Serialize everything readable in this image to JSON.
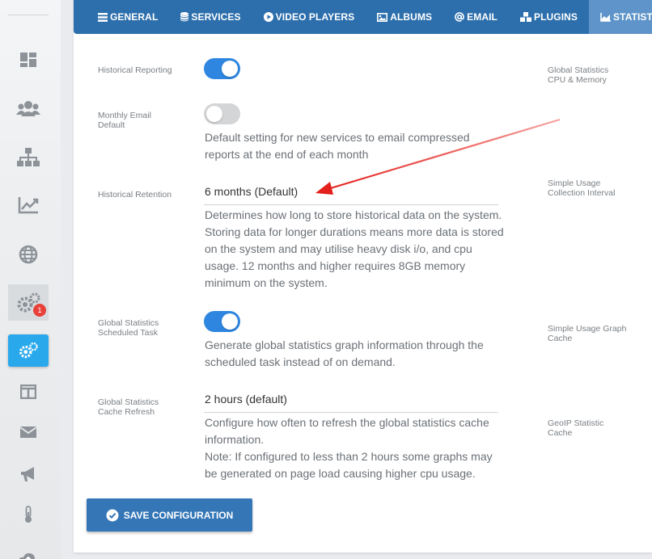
{
  "tabs": [
    {
      "label": "GENERAL",
      "icon": "list-icon",
      "active": false
    },
    {
      "label": "SERVICES",
      "icon": "database-icon",
      "active": false
    },
    {
      "label": "VIDEO PLAYERS",
      "icon": "play-circle-icon",
      "active": false
    },
    {
      "label": "ALBUMS",
      "icon": "image-icon",
      "active": false
    },
    {
      "label": "EMAIL",
      "icon": "at-icon",
      "active": false
    },
    {
      "label": "PLUGINS",
      "icon": "cubes-icon",
      "active": false
    },
    {
      "label": "STATISTICS",
      "icon": "area-chart-icon",
      "active": true
    }
  ],
  "sidebar": {
    "items": [
      "dashboard-icon",
      "users-icon",
      "sitemap-icon",
      "chart-line-icon",
      "globe-icon",
      "cogs-icon",
      "cogs-icon",
      "columns-icon",
      "envelope-icon",
      "megaphone-icon",
      "thermometer-icon",
      "cloud-upload-icon"
    ],
    "badge_count": "1",
    "active_color": "#29a8ec"
  },
  "settings": {
    "historical_reporting": {
      "label": "Historical Reporting",
      "enabled": true
    },
    "monthly_email": {
      "label": "Monthly Email Default",
      "enabled": false,
      "description": "Default setting for new services to email compressed reports at the end of each month"
    },
    "historical_retention": {
      "label": "Historical Retention",
      "value": "6 months (Default)",
      "description": "Determines how long to store historical data on the system. Storing data for longer durations means more data is stored on the system and may utilise heavy disk i/o, and cpu usage. 12 months and higher requires 8GB memory minimum on the system."
    },
    "global_stats_task": {
      "label": "Global Statistics Scheduled Task",
      "enabled": true,
      "description": "Generate global statistics graph information through the scheduled task instead of on demand."
    },
    "global_stats_cache": {
      "label": "Global Statistics Cache Refresh",
      "value": "2 hours (default)",
      "description_1": "Configure how often to refresh the global statistics cache information.",
      "description_2": "Note: If configured to less than 2 hours some graphs may be generated on page load causing higher cpu usage."
    }
  },
  "right_column": [
    "Global Statistics CPU & Memory",
    "Simple Usage Collection Interval",
    "Simple Usage Graph Cache",
    "GeoIP Statistic Cache"
  ],
  "save_button": {
    "label": "SAVE CONFIGURATION"
  },
  "colors": {
    "tab_bar": "#2d6fac",
    "tab_active": "#5e94c9",
    "toggle_on": "#2e86e0",
    "toggle_off": "#d3d5d7",
    "annotation_arrow": "#e3201b"
  }
}
